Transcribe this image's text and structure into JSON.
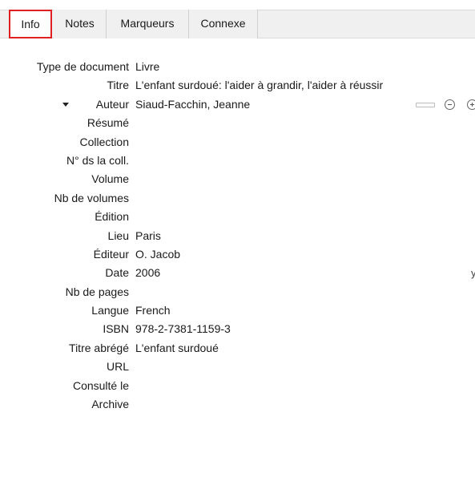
{
  "tabs": [
    {
      "label": "Info",
      "selected": true
    },
    {
      "label": "Notes",
      "selected": false
    },
    {
      "label": "Marqueurs",
      "selected": false
    },
    {
      "label": "Connexe",
      "selected": false
    }
  ],
  "fields": {
    "type_document": {
      "label": "Type de document",
      "value": "Livre"
    },
    "titre": {
      "label": "Titre",
      "value": "L'enfant surdoué: l'aider à grandir, l'aider à réussir"
    },
    "auteur": {
      "label": "Auteur",
      "value": "Siaud-Facchin, Jeanne"
    },
    "resume": {
      "label": "Résumé",
      "value": ""
    },
    "collection": {
      "label": "Collection",
      "value": ""
    },
    "num_coll": {
      "label": "N° ds la coll.",
      "value": ""
    },
    "volume": {
      "label": "Volume",
      "value": ""
    },
    "nb_volumes": {
      "label": "Nb de volumes",
      "value": ""
    },
    "edition": {
      "label": "Édition",
      "value": ""
    },
    "lieu": {
      "label": "Lieu",
      "value": "Paris"
    },
    "editeur": {
      "label": "Éditeur",
      "value": "O. Jacob"
    },
    "date": {
      "label": "Date",
      "value": "2006",
      "flag": "y"
    },
    "nb_pages": {
      "label": "Nb de pages",
      "value": ""
    },
    "langue": {
      "label": "Langue",
      "value": "French"
    },
    "isbn": {
      "label": "ISBN",
      "value": "978-2-7381-1159-3"
    },
    "titre_abrege": {
      "label": "Titre abrégé",
      "value": "L'enfant surdoué"
    },
    "url": {
      "label": "URL",
      "value": ""
    },
    "consulte_le": {
      "label": "Consulté le",
      "value": ""
    },
    "archive": {
      "label": "Archive",
      "value": ""
    }
  },
  "icons": {
    "author_toggle": "chevron-down-icon",
    "creator_type_switch": "switch-icon",
    "remove_creator": "minus-circle-icon",
    "add_creator": "plus-circle-icon"
  },
  "colors": {
    "selected_tab_outline": "#e02020",
    "tab_background": "#f0f0f0"
  }
}
